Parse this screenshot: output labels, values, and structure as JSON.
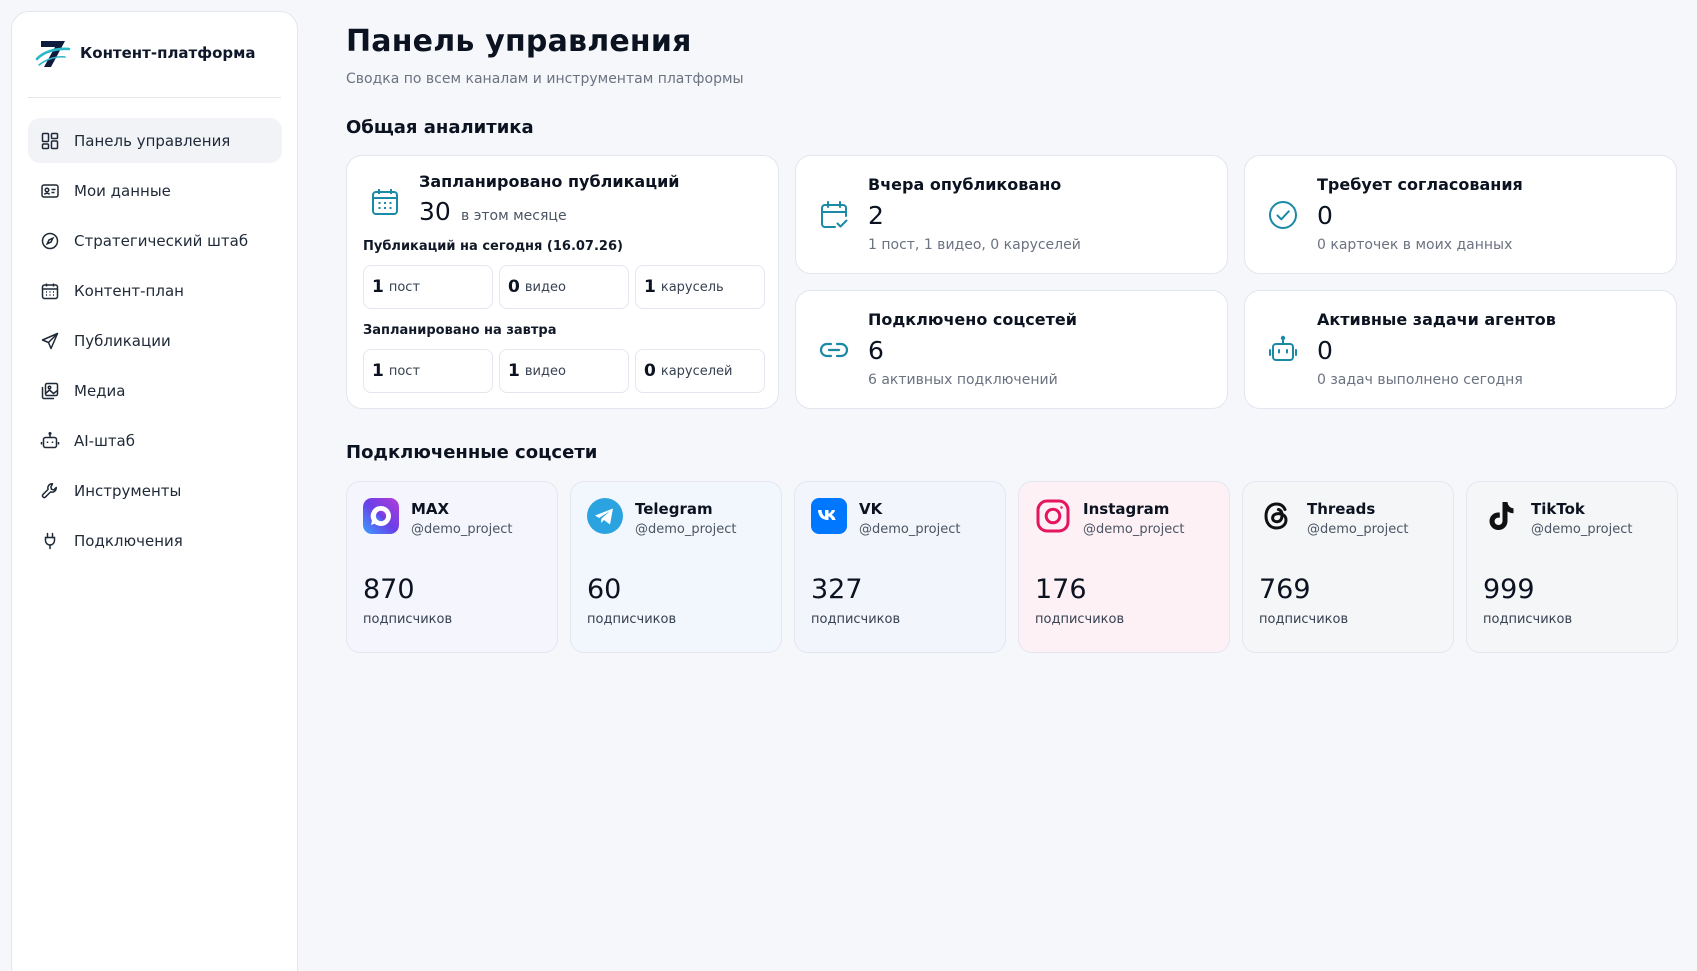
{
  "sidebar": {
    "brand": {
      "name": "Контент-платформа",
      "logo_icon": "logo-7-icon"
    },
    "items": [
      {
        "label": "Панель управления",
        "icon": "dashboard-grid-icon",
        "active": true
      },
      {
        "label": "Мои данные",
        "icon": "id-card-icon",
        "active": false
      },
      {
        "label": "Стратегический штаб",
        "icon": "compass-icon",
        "active": false
      },
      {
        "label": "Контент-план",
        "icon": "calendar-icon",
        "active": false
      },
      {
        "label": "Публикации",
        "icon": "send-icon",
        "active": false
      },
      {
        "label": "Медиа",
        "icon": "images-icon",
        "active": false
      },
      {
        "label": "AI-штаб",
        "icon": "robot-icon",
        "active": false
      },
      {
        "label": "Инструменты",
        "icon": "wrench-icon",
        "active": false
      },
      {
        "label": "Подключения",
        "icon": "plug-icon",
        "active": false
      }
    ]
  },
  "header": {
    "title": "Панель управления",
    "subtitle": "Сводка по всем каналам и инструментам платформы"
  },
  "analytics": {
    "section_title": "Общая аналитика",
    "scheduled": {
      "title": "Запланировано публикаций",
      "value": "30",
      "note": "в этом месяце",
      "today_label": "Публикаций на сегодня (16.07.26)",
      "today": [
        {
          "num": "1",
          "label": "пост"
        },
        {
          "num": "0",
          "label": "видео"
        },
        {
          "num": "1",
          "label": "карусель"
        }
      ],
      "tomorrow_label": "Запланировано на завтра",
      "tomorrow": [
        {
          "num": "1",
          "label": "пост"
        },
        {
          "num": "1",
          "label": "видео"
        },
        {
          "num": "0",
          "label": "каруселей"
        }
      ]
    },
    "yesterday": {
      "title": "Вчера опубликовано",
      "value": "2",
      "note": "1 пост, 1 видео, 0 каруселей"
    },
    "approval": {
      "title": "Требует согласования",
      "value": "0",
      "note": "0 карточек в моих данных"
    },
    "connected": {
      "title": "Подключено соцсетей",
      "value": "6",
      "note": "6 активных подключений"
    },
    "agents": {
      "title": "Активные задачи агентов",
      "value": "0",
      "note": "0 задач выполнено сегодня"
    }
  },
  "socials": {
    "section_title": "Подключенные соцсети",
    "items": [
      {
        "name": "MAX",
        "handle": "@demo_project",
        "count": "870",
        "label": "подписчиков",
        "bg": "#f4f5fd"
      },
      {
        "name": "Telegram",
        "handle": "@demo_project",
        "count": "60",
        "label": "подписчиков",
        "bg": "#f1f7fc"
      },
      {
        "name": "VK",
        "handle": "@demo_project",
        "count": "327",
        "label": "подписчиков",
        "bg": "#f2f5fb"
      },
      {
        "name": "Instagram",
        "handle": "@demo_project",
        "count": "176",
        "label": "подписчиков",
        "bg": "#fdf1f5"
      },
      {
        "name": "Threads",
        "handle": "@demo_project",
        "count": "769",
        "label": "подписчиков",
        "bg": "#f5f6f8"
      },
      {
        "name": "TikTok",
        "handle": "@demo_project",
        "count": "999",
        "label": "подписчиков",
        "bg": "#f5f6f8"
      }
    ]
  },
  "colors": {
    "accent": "#1b8aa6",
    "max_brand": "#6b3ee8",
    "telegram": "#2aa3e0",
    "vk": "#0077ff",
    "instagram": "#e4165f"
  }
}
